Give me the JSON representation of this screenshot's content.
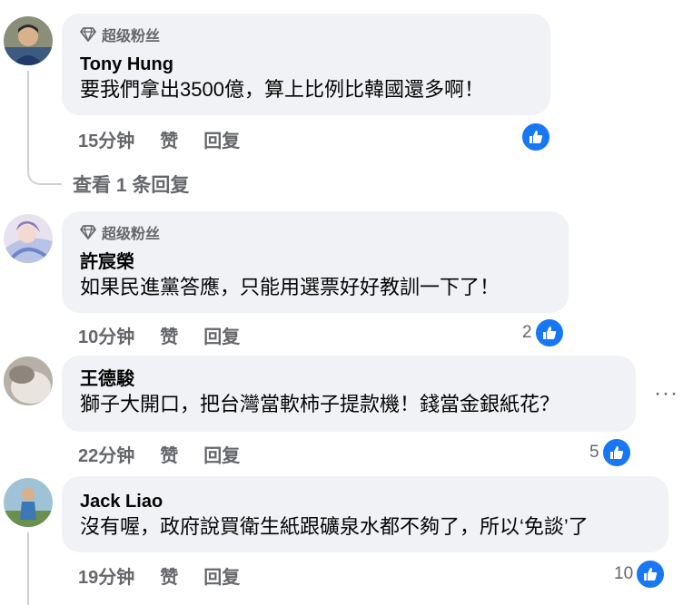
{
  "comments": [
    {
      "badge": "超级粉丝",
      "author": "Tony Hung",
      "text": "要我們拿出3500億，算上比例比韓國還多啊！",
      "time": "15分钟",
      "like_label": "赞",
      "reply_label": "回复",
      "reactions": "",
      "view_replies": "查看 1 条回复"
    },
    {
      "badge": "超级粉丝",
      "author": "許宸榮",
      "text": "如果民進黨答應，只能用選票好好教訓一下了！",
      "time": "10分钟",
      "like_label": "赞",
      "reply_label": "回复",
      "reactions": "2"
    },
    {
      "author": "王德駿",
      "text": "獅子大開口，把台灣當軟柿子提款機！錢當金銀紙花？",
      "time": "22分钟",
      "like_label": "赞",
      "reply_label": "回复",
      "reactions": "5",
      "more": "···"
    },
    {
      "author": "Jack Liao",
      "text": "沒有喔，政府說買衛生紙跟礦泉水都不夠了，所以‘免談’了",
      "time": "19分钟",
      "like_label": "赞",
      "reply_label": "回复",
      "reactions": "10"
    }
  ],
  "icons": {
    "badge": "diamond-icon",
    "reaction": "thumbs-up-icon",
    "more": "more-options-icon"
  },
  "colors": {
    "bubble": "#f0f2f5",
    "meta_text": "#65676b",
    "like_blue": "#1877f2"
  }
}
